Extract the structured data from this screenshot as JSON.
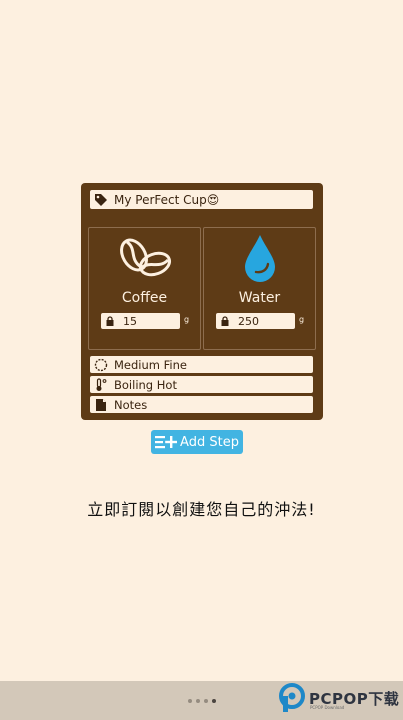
{
  "recipe": {
    "name": "My PerFect Cup😍"
  },
  "coffee": {
    "label": "Coffee",
    "amount": "15",
    "unit": "g"
  },
  "water": {
    "label": "Water",
    "amount": "250",
    "unit": "g"
  },
  "options": {
    "grind": "Medium Fine",
    "temperature": "Boiling Hot",
    "notes": "Notes"
  },
  "actions": {
    "add_step": "Add Step"
  },
  "promo": {
    "text": "立即訂閱以創建您自己的沖法!"
  },
  "pager": {
    "total": 4,
    "active": 4
  },
  "watermark": {
    "text": "PCPOP下载",
    "sub": "PCPOP Download"
  },
  "colors": {
    "card": "#5e3b16",
    "cream": "#fdf0e0",
    "water_drop": "#27a6df",
    "button": "#42b4e2"
  }
}
